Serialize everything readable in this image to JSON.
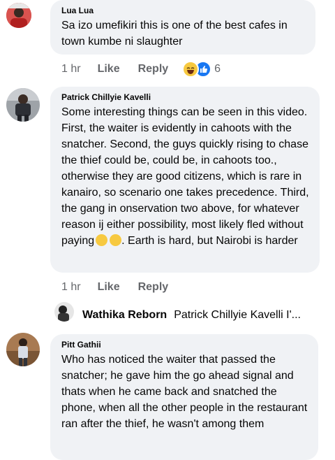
{
  "comments": [
    {
      "author": "Lua Lua",
      "text": "Sa izo umefikiri this is one of the best cafes in town kumbe ni slaughter",
      "time": "1 hr",
      "like": "Like",
      "reply": "Reply",
      "reaction_count": "6",
      "reaction_icons": [
        "laughing-emoji-icon",
        "like-thumb-icon"
      ]
    },
    {
      "author": "Patrick Chillyie Kavelli",
      "text_part1": "Some interesting things can be seen in this video. First, the waiter is evidently in cahoots with the snatcher. Second, the guys quickly rising to chase the thief could be, could be, in cahoots too., otherwise they are good citizens, which is rare in kanairo, so scenario one takes precedence. Third, the gang in onservation two above, for whatever reason ij either possibility, most likely fled without paying",
      "text_part2": ". Earth is hard, but Nairobi is harder",
      "time": "1 hr",
      "like": "Like",
      "reply": "Reply"
    },
    {
      "author": "Pitt Gathii",
      "text": "Who has noticed the waiter that passed the snatcher; he gave him the go ahead signal and thats when he came back and snatched the phone, when all the other people in the restaurant ran after the thief, he wasn't among them"
    }
  ],
  "reply_preview": {
    "name": "Wathika Reborn",
    "text": "Patrick Chillyie Kavelli I'..."
  }
}
